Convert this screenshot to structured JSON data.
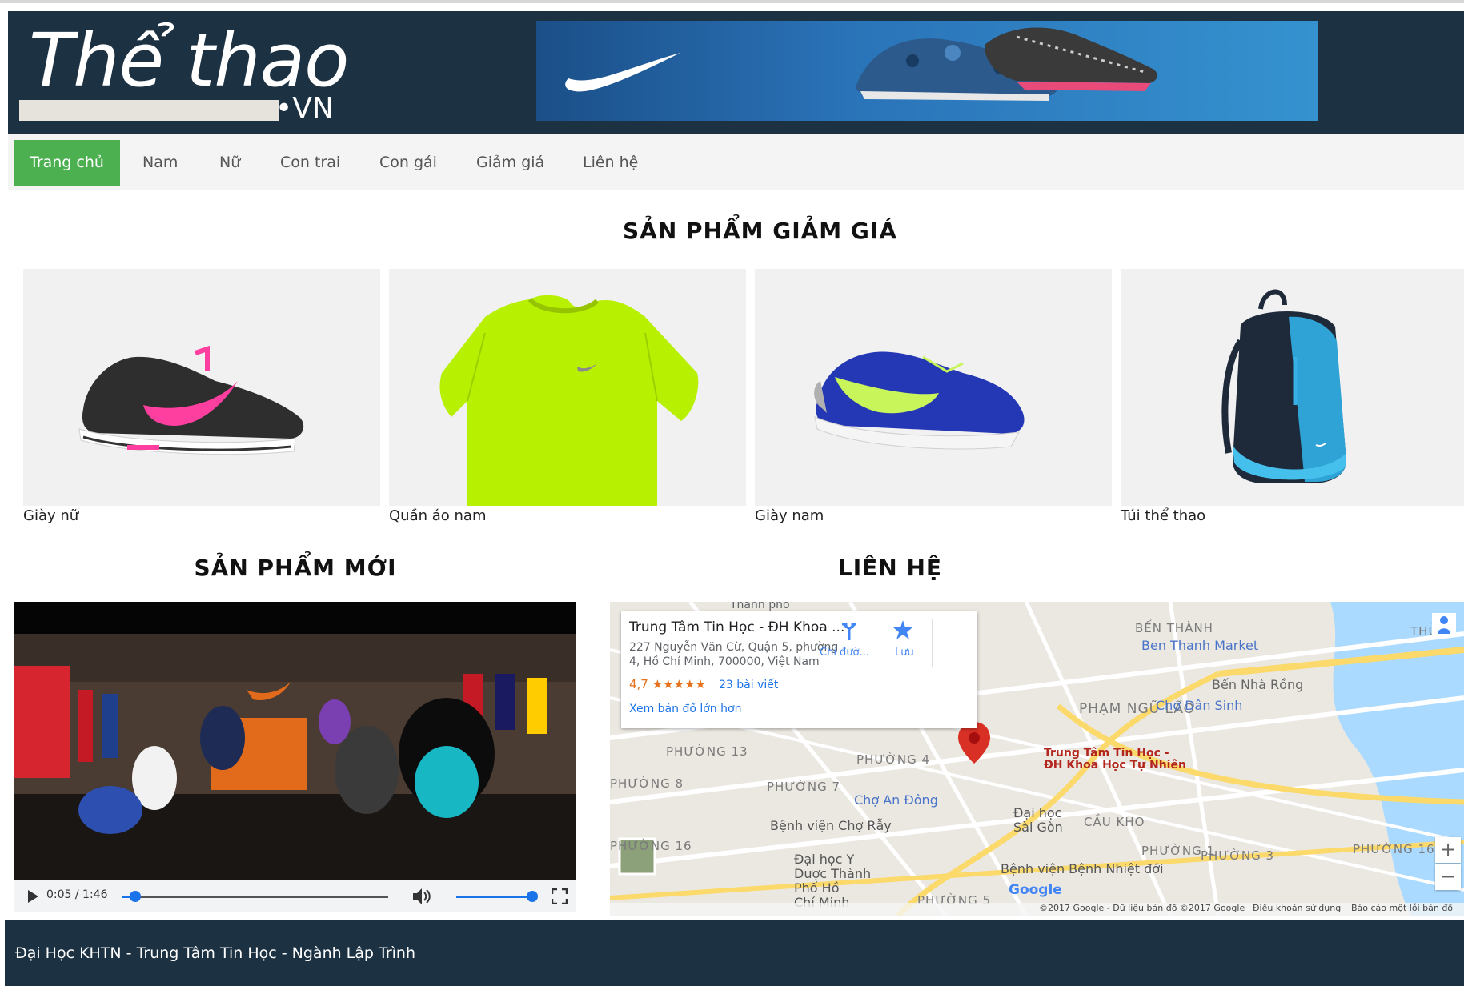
{
  "site": {
    "logo_main": "Thể thao",
    "logo_suffix": "•VN"
  },
  "nav": {
    "items": [
      {
        "label": "Trang chủ",
        "active": true
      },
      {
        "label": "Nam"
      },
      {
        "label": "Nữ"
      },
      {
        "label": "Con trai"
      },
      {
        "label": "Con gái"
      },
      {
        "label": "Giảm giá"
      },
      {
        "label": "Liên hệ"
      }
    ]
  },
  "sale": {
    "title": "SẢN PHẨM GIẢM GIÁ",
    "products": [
      {
        "caption": "Giày nữ",
        "icon": "womens-shoe-image"
      },
      {
        "caption": "Quần áo nam",
        "icon": "mens-shirt-image"
      },
      {
        "caption": "Giày nam",
        "icon": "mens-shoe-image"
      },
      {
        "caption": "Túi thể thao",
        "icon": "backpack-image"
      }
    ]
  },
  "new_products": {
    "title": "SẢN PHẨM MỚI",
    "video": {
      "time": "0:05 / 1:46",
      "progress": 0.047,
      "volume": 0.95
    }
  },
  "contact": {
    "title": "LIÊN HỆ",
    "map": {
      "place_name": "Trung Tâm Tin Học - ĐH Khoa ...",
      "address_line1": "227 Nguyễn Văn Cừ, Quận 5, phường",
      "address_line2": "4, Hồ Chí Minh, 700000, Việt Nam",
      "rating": "4,7",
      "stars": "★★★★★",
      "reviews": "23 bài viết",
      "larger_map": "Xem bản đồ lớn hơn",
      "directions": "Chỉ đườ...",
      "save": "Lưu",
      "marker_label_1": "Trung Tâm Tin Học -",
      "marker_label_2": "ĐH Khoa Học Tự Nhiên",
      "attribution": "©2017 Google - Dữ liệu bản đồ ©2017 Google",
      "terms": "Điều khoản sử dụng",
      "report": "Báo cáo một lỗi bản đồ",
      "google": "Google",
      "zoom_in": "+",
      "zoom_out": "−",
      "labels": {
        "ben_thanh": "BẾN THÀNH",
        "ben_thanh_market": "Ben Thanh Market",
        "ben_nha_rong": "Bến Nhà Rồng",
        "pham_ngu_lao": "PHẠM NGŨ LÃO",
        "cho_dan_sinh": "Chợ Dân Sinh",
        "phuong13": "PHƯỜNG 13",
        "phuong4": "PHƯỜNG 4",
        "phuong8": "PHƯỜNG 8",
        "phuong7": "PHƯỜNG 7",
        "cho_an_dong": "Chợ An Đông",
        "benh_vien_cho_ray": "Bệnh viện Chợ Rẫy",
        "dai_hoc_sai_gon_1": "Đại học",
        "dai_hoc_sai_gon_2": "Sài Gòn",
        "cau_kho": "CẦU KHO",
        "phuong16a": "PHƯỜNG 16",
        "phuong1": "PHƯỜNG 1",
        "phuong3": "PHƯỜNG 3",
        "phuong16b": "PHƯỜNG 16",
        "dai_hoc_y_1": "Đại học Y",
        "dai_hoc_y_2": "Dược Thành",
        "dai_hoc_y_3": "Phố Hồ",
        "dai_hoc_y_4": "Chí Minh",
        "benh_vien_nhiet_doi": "Bệnh viện Bệnh Nhiệt đới",
        "phuong5": "PHƯỜNG 5",
        "thu": "THỦ",
        "thanh_pho": "Thành phố"
      }
    }
  },
  "footer": {
    "text": "Đại Học KHTN - Trung Tâm Tin Học - Ngành Lập Trình"
  },
  "colors": {
    "header_bg": "#1c3142",
    "nav_active": "#4caf50",
    "map_marker": "#d93025",
    "link_blue": "#1a73e8"
  }
}
